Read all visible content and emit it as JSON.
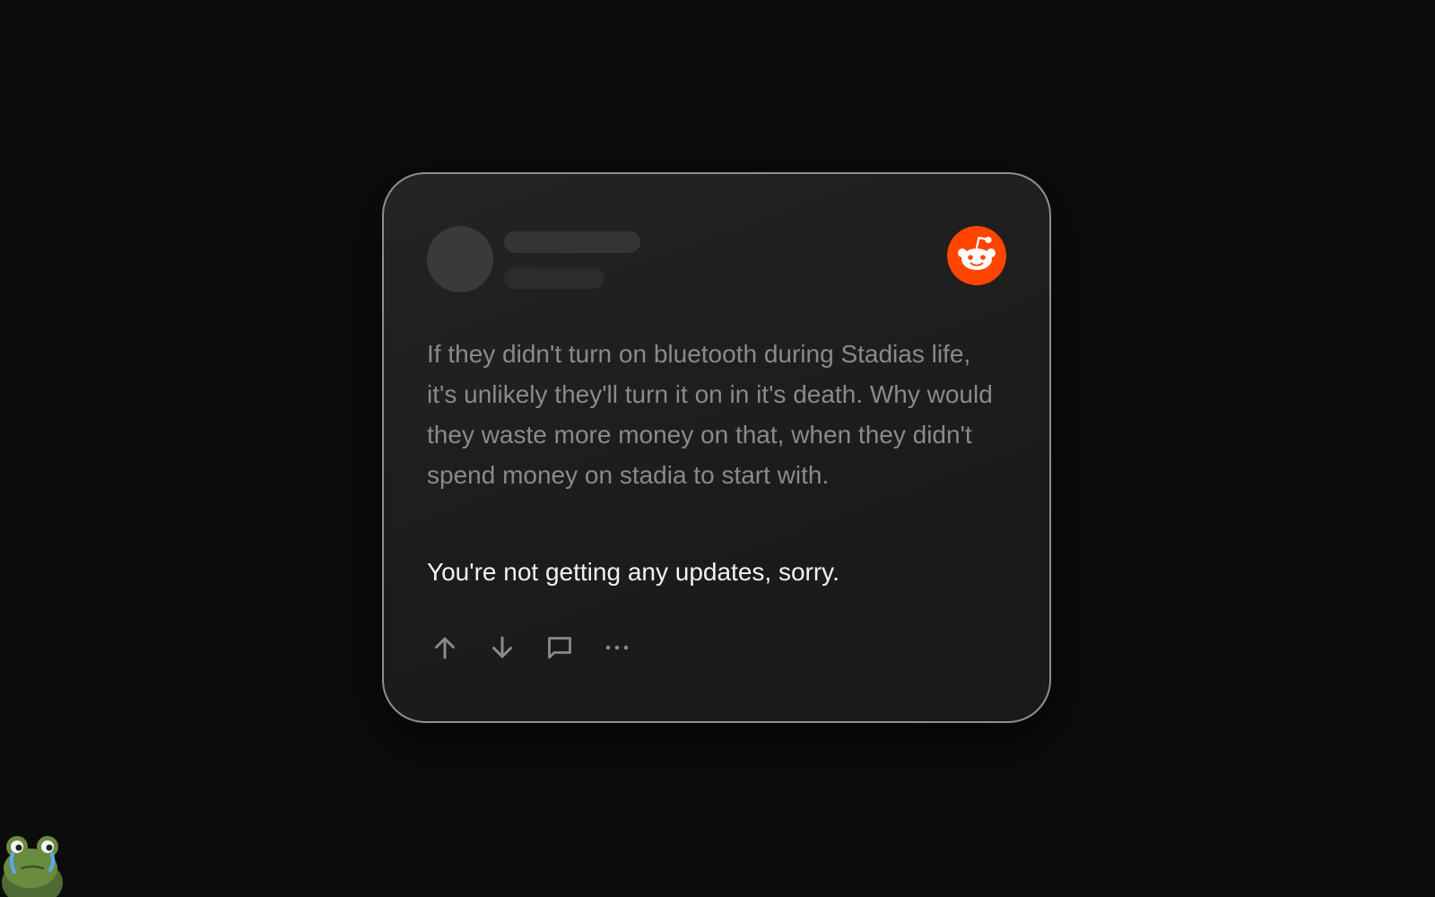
{
  "colors": {
    "background": "#0c0c0c",
    "brand": "#ff4500",
    "body_text": "#8a8a8a",
    "highlight_text": "#f2f2f2",
    "icon": "#8a8a8a"
  },
  "post": {
    "logo_icon": "reddit-logo-icon",
    "body": "If they didn't turn on bluetooth during Stadias life, it's unlikely they'll turn it on in it's death. Why would they waste more money on that, when they didn't spend money on stadia to start with.",
    "highlight": "You're not getting any updates, sorry."
  },
  "actions": [
    {
      "icon": "upvote-arrow-icon"
    },
    {
      "icon": "downvote-arrow-icon"
    },
    {
      "icon": "comment-icon"
    },
    {
      "icon": "more-options-icon"
    }
  ],
  "decoration": {
    "icon": "crying-frog-icon"
  }
}
